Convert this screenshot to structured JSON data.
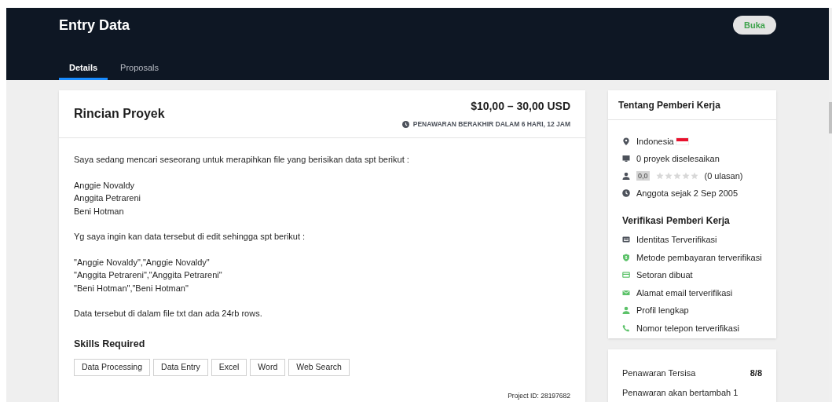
{
  "header": {
    "title": "Entry Data",
    "status_button": "Buka"
  },
  "tabs": [
    {
      "label": "Details",
      "selected": true
    },
    {
      "label": "Proposals",
      "selected": false
    }
  ],
  "project": {
    "title": "Rincian Proyek",
    "budget": "$10,00 – 30,00 USD",
    "deadline": "PENAWARAN BERAKHIR DALAM 6 HARI, 12 JAM",
    "description": [
      "Saya sedang mencari seseorang untuk merapihkan file yang berisikan data spt berikut :",
      "Anggie Novaldy\nAnggita Petrareni\nBeni Hotman",
      "Yg saya ingin kan data tersebut di edit sehingga spt berikut :",
      "\"Anggie Novaldy\",\"Anggie Novaldy\"\n\"Anggita Petrareni\",\"Anggita Petrareni\"\n\"Beni Hotman\",\"Beni Hotman\"",
      "Data tersebut di dalam file txt dan ada 24rb rows."
    ],
    "skills_title": "Skills Required",
    "skills": [
      "Data Processing",
      "Data Entry",
      "Excel",
      "Word",
      "Web Search"
    ],
    "project_id": "Project ID: 28197682"
  },
  "employer": {
    "title": "Tentang Pemberi Kerja",
    "items": [
      {
        "kind": "location",
        "text": "Indonesia"
      },
      {
        "kind": "projects",
        "text": "0 proyek diselesaikan"
      },
      {
        "kind": "rating",
        "score": "0,0",
        "stars": 0,
        "text": "(0 ulasan)"
      },
      {
        "kind": "member",
        "text": "Anggota sejak 2 Sep 2005"
      }
    ],
    "verification_title": "Verifikasi Pemberi Kerja",
    "verifications": [
      {
        "kind": "identity",
        "text": "Identitas Terverifikasi",
        "verified": false
      },
      {
        "kind": "payment",
        "text": "Metode pembayaran terverifikasi",
        "verified": true
      },
      {
        "kind": "deposit",
        "text": "Setoran dibuat",
        "verified": true
      },
      {
        "kind": "email",
        "text": "Alamat email terverifikasi",
        "verified": true
      },
      {
        "kind": "profile",
        "text": "Profil lengkap",
        "verified": true
      },
      {
        "kind": "phone",
        "text": "Nomor telepon terverifikasi",
        "verified": true
      }
    ]
  },
  "bids": {
    "label": "Penawaran Tersisa",
    "value": "8/8",
    "note": "Penawaran akan bertambah 1"
  }
}
